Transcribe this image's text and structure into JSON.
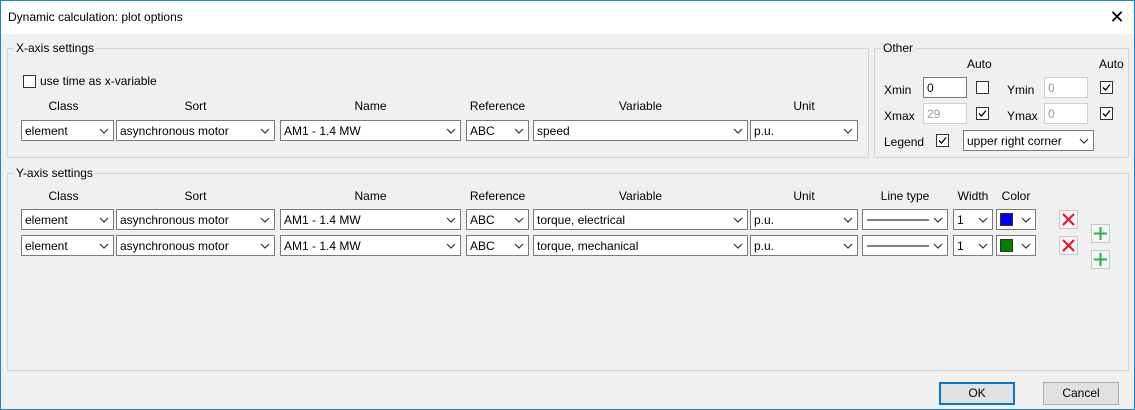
{
  "window": {
    "title": "Dynamic calculation: plot options"
  },
  "icons": {
    "close": "close-icon",
    "dropdown": "chevron-down-icon",
    "delete": "red-x-delete-icon",
    "add": "green-plus-add-icon",
    "check": "checkmark-icon"
  },
  "colors": {
    "accent": "#0078d7",
    "delete_icon": "#e81123",
    "add_icon": "#22b14c",
    "swatch_blue": "#0000ff",
    "swatch_green": "#008000"
  },
  "x_axis": {
    "group_label": "X-axis settings",
    "use_time_label": "use time as x-variable",
    "use_time_checked": false,
    "headers": {
      "class": "Class",
      "sort": "Sort",
      "name": "Name",
      "reference": "Reference",
      "variable": "Variable",
      "unit": "Unit"
    },
    "row": {
      "class": "element",
      "sort": "asynchronous motor",
      "name": "AM1 - 1.4 MW",
      "reference": "ABC",
      "variable": "speed",
      "unit": "p.u."
    }
  },
  "other": {
    "group_label": "Other",
    "auto_label": "Auto",
    "xmin_label": "Xmin",
    "xmin_value": "0",
    "xmin_auto": false,
    "xmax_label": "Xmax",
    "xmax_value": "29",
    "xmax_auto": true,
    "ymin_label": "Ymin",
    "ymin_value": "0",
    "ymin_auto": true,
    "ymax_label": "Ymax",
    "ymax_value": "0",
    "ymax_auto": true,
    "legend_label": "Legend",
    "legend_checked": true,
    "legend_position": "upper right corner"
  },
  "y_axis": {
    "group_label": "Y-axis settings",
    "headers": {
      "class": "Class",
      "sort": "Sort",
      "name": "Name",
      "reference": "Reference",
      "variable": "Variable",
      "unit": "Unit",
      "line_type": "Line type",
      "width": "Width",
      "color": "Color"
    },
    "rows": [
      {
        "class": "element",
        "sort": "asynchronous motor",
        "name": "AM1 - 1.4 MW",
        "reference": "ABC",
        "variable": "torque, electrical",
        "unit": "p.u.",
        "width": "1",
        "color": "#0000ff"
      },
      {
        "class": "element",
        "sort": "asynchronous motor",
        "name": "AM1 - 1.4 MW",
        "reference": "ABC",
        "variable": "torque, mechanical",
        "unit": "p.u.",
        "width": "1",
        "color": "#008000"
      }
    ]
  },
  "buttons": {
    "ok": "OK",
    "cancel": "Cancel"
  }
}
